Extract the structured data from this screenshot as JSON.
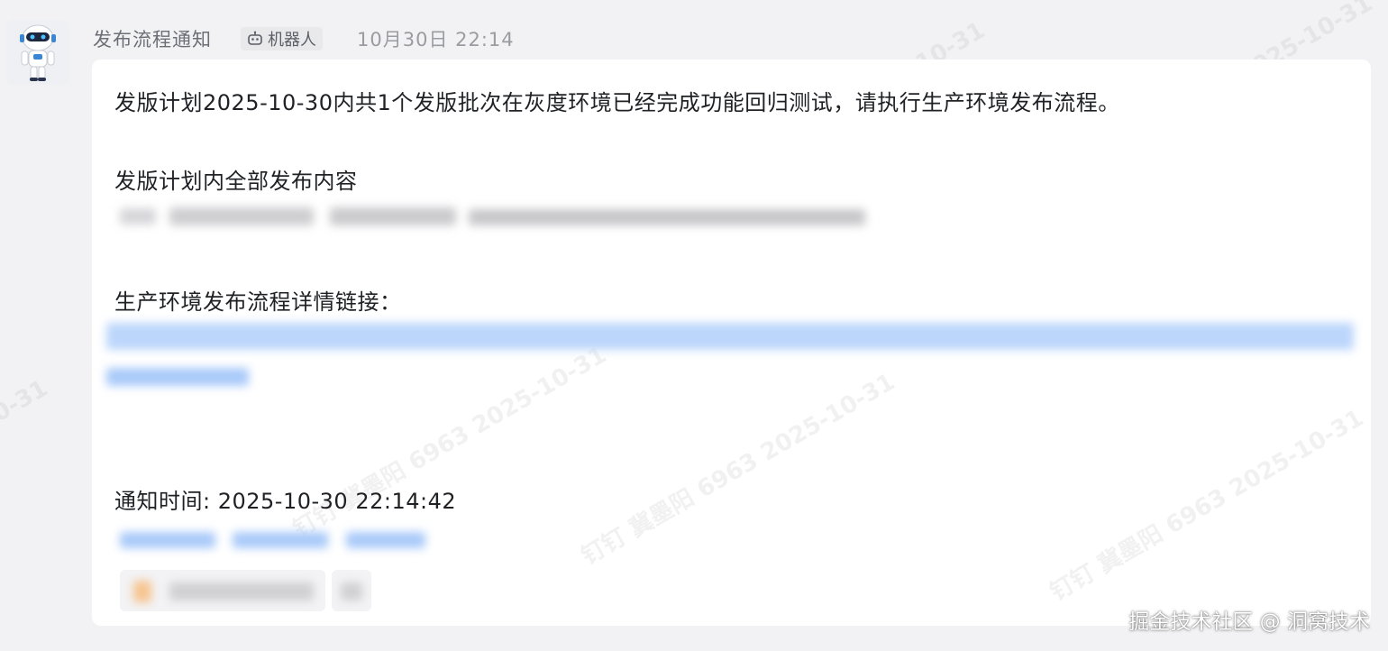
{
  "header": {
    "sender": "发布流程通知",
    "badge_label": "机器人",
    "timestamp": "10月30日 22:14"
  },
  "message": {
    "line1": "发版计划2025-10-30内共1个发版批次在灰度环境已经完成功能回归测试，请执行生产环境发布流程。",
    "content_heading": "发版计划内全部发布内容",
    "link_heading": "生产环境发布流程详情链接：",
    "notify_time": "通知时间: 2025-10-30 22:14:42"
  },
  "watermark": {
    "text": "钉钉 冀墨阳 6963 2025-10-31",
    "fragment": "0-31"
  },
  "footer": {
    "credit": "掘金技术社区 @ 洞窝技术"
  },
  "icons": {
    "avatar": "robot-avatar-icon",
    "badge": "robot-icon"
  },
  "colors": {
    "background": "#f2f2f4",
    "bubble": "#ffffff",
    "text": "#1f2124",
    "muted": "#9a9ca2",
    "link_blur": "#bcd6fb"
  }
}
